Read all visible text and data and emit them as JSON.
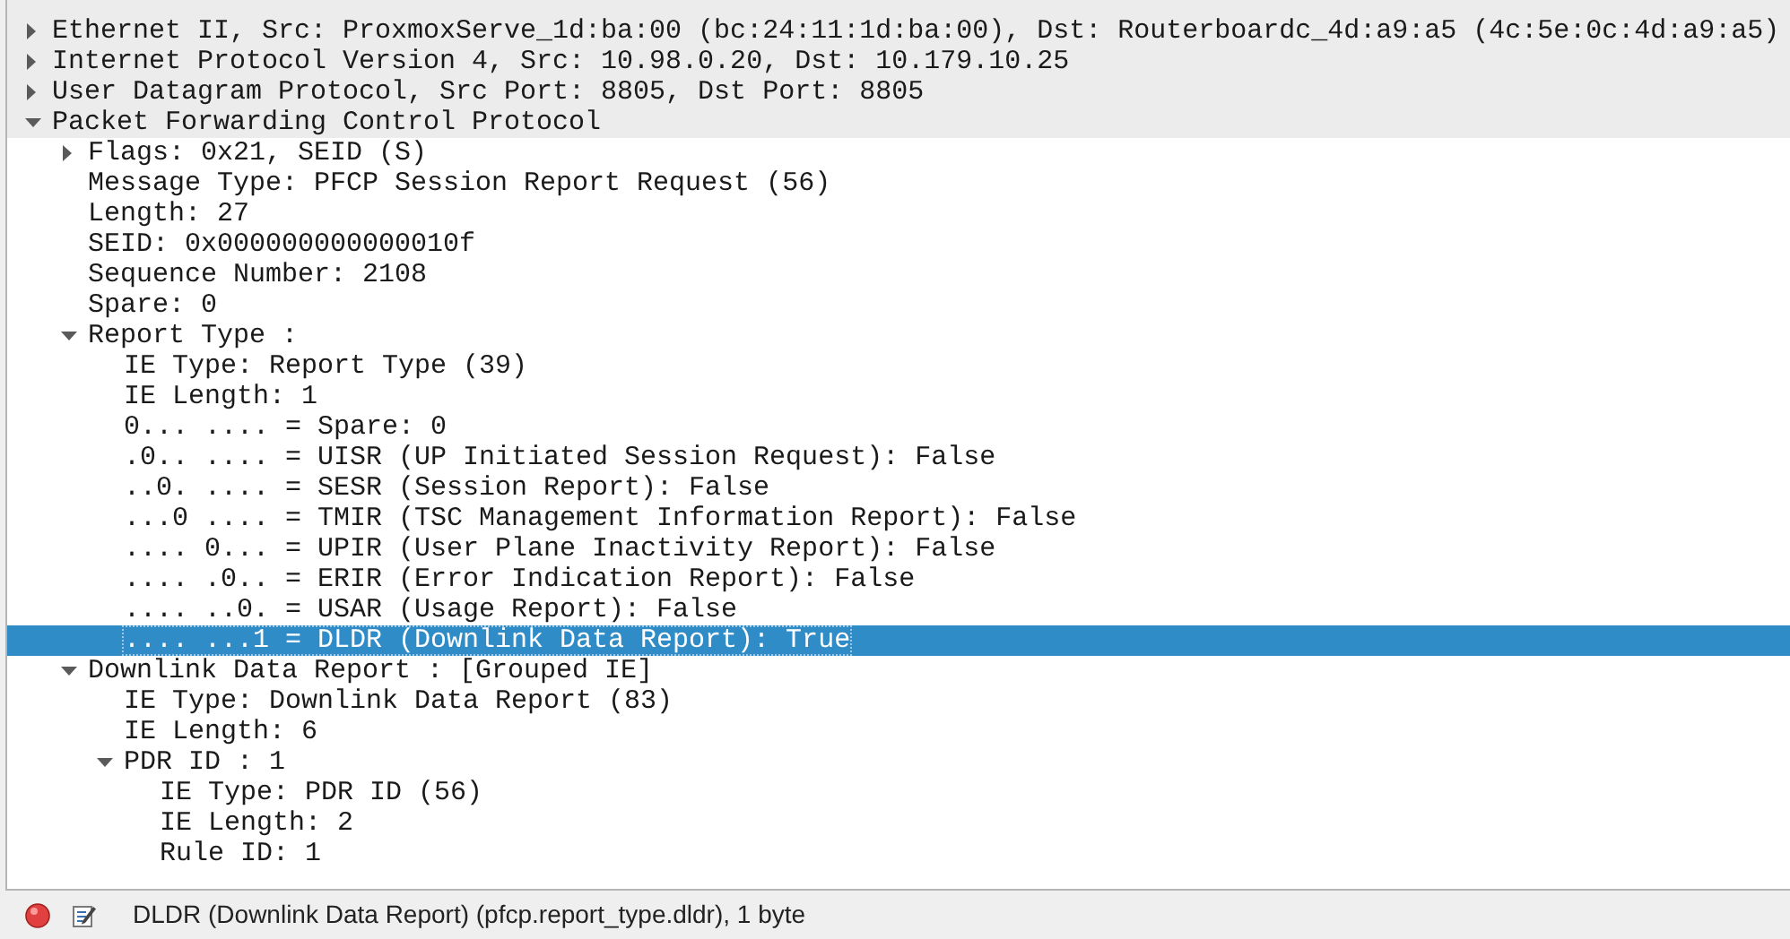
{
  "tree": [
    {
      "label": "Ethernet II, Src: ProxmoxServe_1d:ba:00 (bc:24:11:1d:ba:00), Dst: Routerboardc_4d:a9:a5 (4c:5e:0c:4d:a9:a5)",
      "expanded": false,
      "selected": false
    },
    {
      "label": "Internet Protocol Version 4, Src: 10.98.0.20, Dst: 10.179.10.25",
      "expanded": false,
      "selected": false
    },
    {
      "label": "User Datagram Protocol, Src Port: 8805, Dst Port: 8805",
      "expanded": false,
      "selected": false
    },
    {
      "label": "Packet Forwarding Control Protocol",
      "expanded": true,
      "selected": false,
      "children": [
        {
          "label": "Flags: 0x21, SEID (S)",
          "expanded": false,
          "selected": false
        },
        {
          "label": "Message Type: PFCP Session Report Request (56)",
          "selected": false
        },
        {
          "label": "Length: 27",
          "selected": false
        },
        {
          "label": "SEID: 0x000000000000010f",
          "selected": false
        },
        {
          "label": "Sequence Number: 2108",
          "selected": false
        },
        {
          "label": "Spare: 0",
          "selected": false
        },
        {
          "label": "Report Type :",
          "expanded": true,
          "selected": false,
          "children": [
            {
              "label": "IE Type: Report Type (39)",
              "selected": false
            },
            {
              "label": "IE Length: 1",
              "selected": false
            },
            {
              "label": "0... .... = Spare: 0",
              "selected": false
            },
            {
              "label": ".0.. .... = UISR (UP Initiated Session Request): False",
              "selected": false
            },
            {
              "label": "..0. .... = SESR (Session Report): False",
              "selected": false
            },
            {
              "label": "...0 .... = TMIR (TSC Management Information Report): False",
              "selected": false
            },
            {
              "label": ".... 0... = UPIR (User Plane Inactivity Report): False",
              "selected": false
            },
            {
              "label": ".... .0.. = ERIR (Error Indication Report): False",
              "selected": false
            },
            {
              "label": ".... ..0. = USAR (Usage Report): False",
              "selected": false
            },
            {
              "label": ".... ...1 = DLDR (Downlink Data Report): True",
              "selected": true
            }
          ]
        },
        {
          "label": "Downlink Data Report : [Grouped IE]",
          "expanded": true,
          "selected": false,
          "children": [
            {
              "label": "IE Type: Downlink Data Report (83)",
              "selected": false
            },
            {
              "label": "IE Length: 6",
              "selected": false
            },
            {
              "label": "PDR ID : 1",
              "expanded": true,
              "selected": false,
              "children": [
                {
                  "label": "IE Type: PDR ID (56)",
                  "selected": false
                },
                {
                  "label": "IE Length: 2",
                  "selected": false
                },
                {
                  "label": "Rule ID: 1",
                  "selected": false
                }
              ]
            }
          ]
        }
      ]
    }
  ],
  "status_bar": {
    "text": "DLDR (Downlink Data Report) (pfcp.report_type.dldr), 1 byte"
  }
}
